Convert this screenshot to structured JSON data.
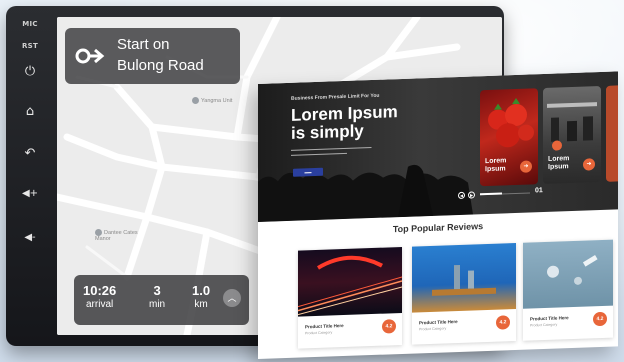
{
  "device": {
    "side_buttons": [
      {
        "label": "MIC",
        "kind": "text"
      },
      {
        "label": "RST",
        "kind": "text"
      },
      {
        "icon": "power-icon",
        "glyph": "⏻"
      },
      {
        "icon": "home-icon",
        "glyph": "⌂"
      },
      {
        "icon": "back-icon",
        "glyph": "↶"
      },
      {
        "icon": "volume-up-icon",
        "glyph": "◀+"
      },
      {
        "icon": "volume-down-icon",
        "glyph": "◀-"
      }
    ]
  },
  "navigation": {
    "turn_line1": "Start on",
    "turn_line2": "Bulong Road",
    "eta": {
      "arrival_time": "10:26",
      "arrival_label": "arrival",
      "duration_value": "3",
      "duration_unit": "min",
      "distance_value": "1.0",
      "distance_unit": "km"
    },
    "pois": [
      "Yangma Unit",
      "Dantee Cates Manor"
    ]
  },
  "website": {
    "hero_kicker": "Business From Presale Limit For You",
    "hero_title_line1": "Lorem Ipsum",
    "hero_title_line2": "is simply",
    "slides": [
      {
        "label_line1": "Lorem",
        "label_line2": "Ipsum"
      },
      {
        "label_line1": "Lorem",
        "label_line2": "Ipsum"
      }
    ],
    "pager_number": "01",
    "section_title": "Top Popular Reviews",
    "cards": [
      {
        "title": "Product Title Here",
        "category": "Product Category",
        "score": "4.2"
      },
      {
        "title": "Product Title Here",
        "category": "Product Category",
        "score": "4.2"
      },
      {
        "title": "Product Title Here",
        "category": "Product Category",
        "score": "4.2"
      }
    ]
  },
  "colors": {
    "accent_orange": "#e8663a",
    "button_blue": "#2a3f9e",
    "map_background": "#ececec"
  }
}
